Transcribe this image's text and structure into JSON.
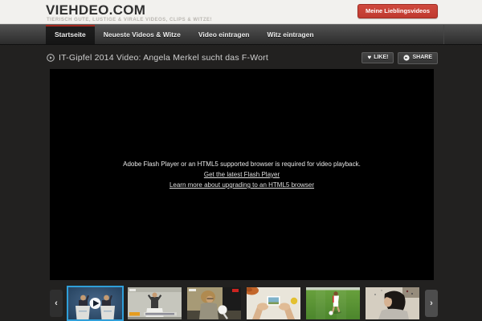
{
  "header": {
    "logo": "VIEHDEO.COM",
    "tagline": "TIERISCH GUTE, LUSTIGE & VIRALE VIDEOS, CLIPS & WITZE!",
    "favorites_button": "Meine Lieblingsvideos"
  },
  "nav": {
    "items": [
      {
        "label": "Startseite",
        "active": true
      },
      {
        "label": "Neueste Videos & Witze",
        "active": false
      },
      {
        "label": "Video eintragen",
        "active": false
      },
      {
        "label": "Witz eintragen",
        "active": false
      }
    ]
  },
  "page": {
    "title": "IT-Gipfel 2014 Video: Angela Merkel sucht das F-Wort",
    "like_button": "LIKE!",
    "share_button": "SHARE"
  },
  "player": {
    "message": "Adobe Flash Player or an HTML5 supported browser is required for video playback.",
    "flash_link": "Get the latest Flash Player",
    "html5_link": "Learn more about upgrading to an HTML5 browser"
  },
  "carousel": {
    "prev_label": "‹",
    "next_label": "›",
    "thumbnails": [
      {
        "name": "tv-debate-two-podiums",
        "active": true
      },
      {
        "name": "bundestag-speech",
        "active": false
      },
      {
        "name": "street-interview-microphone",
        "active": false
      },
      {
        "name": "hands-holding-photo",
        "active": false
      },
      {
        "name": "soccer-player-on-pitch",
        "active": false
      },
      {
        "name": "girl-dark-hair-room",
        "active": false
      }
    ]
  },
  "icons": {
    "title_play_icon": "play-circle",
    "like_icon": "heart",
    "share_icon": "arrow-circle",
    "thumbnail_play_overlay": "play-circle"
  },
  "colors": {
    "accent_red": "#c03a30",
    "active_tab_red": "#a3261d",
    "active_thumb_border": "#2f9fd9",
    "header_bg": "#f2f1ee",
    "nav_bg_top": "#515151",
    "content_bg": "#222120",
    "player_bg": "#000000"
  }
}
